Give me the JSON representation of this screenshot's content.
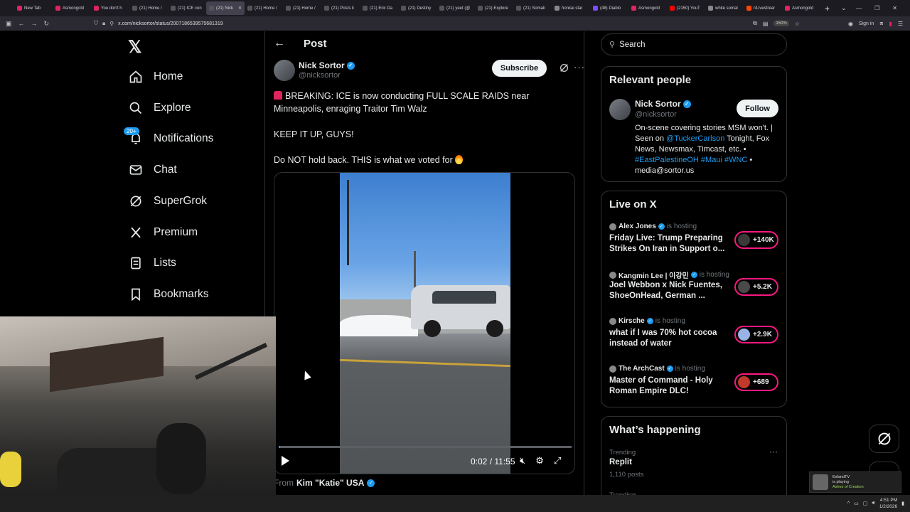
{
  "browser": {
    "tabs": [
      {
        "label": "New Tab",
        "color": "#e0245e"
      },
      {
        "label": "Asmongold",
        "color": "#e0245e"
      },
      {
        "label": "You don't h",
        "color": "#e0245e"
      },
      {
        "label": "(21) Home /",
        "color": "#555555"
      },
      {
        "label": "(21) ICE con",
        "color": "#555555"
      },
      {
        "label": "(21) Nick",
        "color": "#555555",
        "active": true
      },
      {
        "label": "(21) Home /",
        "color": "#555555"
      },
      {
        "label": "(21) Home /",
        "color": "#555555"
      },
      {
        "label": "(21) Posts li",
        "color": "#555555"
      },
      {
        "label": "(21) Eric Da",
        "color": "#555555"
      },
      {
        "label": "(21) Destiny",
        "color": "#555555"
      },
      {
        "label": "(21) yeet (@",
        "color": "#555555"
      },
      {
        "label": "(21) Explore",
        "color": "#555555"
      },
      {
        "label": "(21) Somali",
        "color": "#555555"
      },
      {
        "label": "honkai star",
        "color": "#888888"
      },
      {
        "label": "(48) Diablo",
        "color": "#7c4dff"
      },
      {
        "label": "Asmongold",
        "color": "#e0245e"
      },
      {
        "label": "(2150) YouT",
        "color": "#ff0000"
      },
      {
        "label": "white somal",
        "color": "#888888"
      },
      {
        "label": "r/Livestrear",
        "color": "#ff4500"
      },
      {
        "label": "Asmongold",
        "color": "#e0245e"
      }
    ],
    "url": "x.com/nicksortor/status/2007186539575681319",
    "zoom": "150%",
    "sign_in": "Sign in"
  },
  "left_nav": {
    "items": [
      {
        "label": "Home",
        "icon": "home-icon"
      },
      {
        "label": "Explore",
        "icon": "search-icon"
      },
      {
        "label": "Notifications",
        "icon": "bell-icon",
        "badge": "20+"
      },
      {
        "label": "Chat",
        "icon": "mail-icon"
      },
      {
        "label": "SuperGrok",
        "icon": "grok-icon"
      },
      {
        "label": "Premium",
        "icon": "x-logo-icon"
      },
      {
        "label": "Lists",
        "icon": "list-icon"
      },
      {
        "label": "Bookmarks",
        "icon": "bookmark-icon"
      }
    ]
  },
  "post": {
    "header_title": "Post",
    "author": {
      "name": "Nick Sortor",
      "handle": "@nicksortor"
    },
    "subscribe_label": "Subscribe",
    "text_line1": "BREAKING: ICE is now conducting FULL SCALE RAIDS near Minneapolis, enraging Traitor Tim Walz",
    "text_line2": "KEEP IT UP, GUYS!",
    "text_line3": "Do NOT hold back. THIS is what we voted for",
    "video": {
      "time": "0:02 / 11:55",
      "progress": 0.003
    },
    "from_prefix": "From",
    "from_name": "Kim \"Katie\" USA"
  },
  "sidebar": {
    "search_placeholder": "Search",
    "relevant_people": {
      "title": "Relevant people",
      "name": "Nick Sortor",
      "handle": "@nicksortor",
      "follow_label": "Follow",
      "bio_1": "On-scene covering stories MSM won't. | Seen on ",
      "bio_link": "@TuckerCarlson",
      "bio_2": " Tonight, Fox News, Newsmax, Timcast, etc. • ",
      "bio_tags": "#EastPalestineOH #Maui #WNC",
      "bio_3": " • media@sortor.us"
    },
    "live": {
      "title": "Live on X",
      "hosting_label": "is hosting",
      "items": [
        {
          "host": "Alex Jones",
          "title": "Friday Live: Trump Preparing Strikes On Iran in Support o...",
          "count": "+140K"
        },
        {
          "host": "Kangmin Lee | 이강민",
          "title": "Joel Webbon x Nick Fuentes, ShoeOnHead, German ...",
          "count": "+5.2K"
        },
        {
          "host": "Kirsche",
          "title": "what if I was 70% hot cocoa instead of water",
          "count": "+2.9K"
        },
        {
          "host": "The ArchCast",
          "title": "Master of Command - Holy Roman Empire DLC!",
          "count": "+689"
        }
      ]
    },
    "happening": {
      "title": "What’s happening",
      "trend_label": "Trending",
      "topic": "Replit",
      "posts": "1,110 posts",
      "trend_label_2": "Trending"
    }
  },
  "taskbar": {
    "time": "4:51 PM",
    "date": "1/2/2026"
  },
  "stream_toast": {
    "name": "EsfandTV",
    "status": "is playing",
    "game": "Ashes of Creation"
  }
}
